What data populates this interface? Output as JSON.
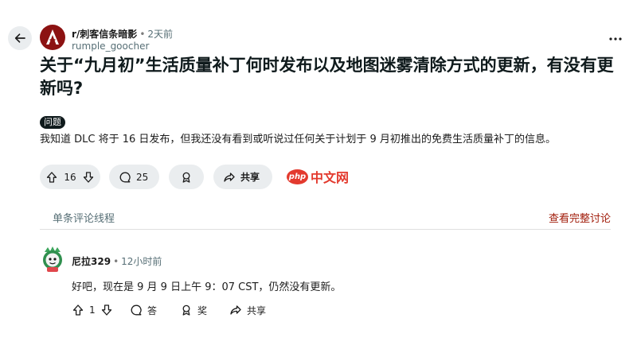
{
  "post": {
    "subreddit": "r/刺客信条暗影",
    "time": "2天前",
    "author": "rumple_goocher",
    "title": "关于“九月初”生活质量补丁何时发布以及地图迷雾清除方式的更新，有没有更新吗?",
    "flair": "问题",
    "body": "我知道 DLC 将于 16 日发布，但我还没有看到或听说过任何关于计划于 9 月初推出的免费生活质量补丁的信息。",
    "votes": "16",
    "comments": "25",
    "share_label": "共享"
  },
  "watermark": {
    "logo_text": "php",
    "text": "中文网"
  },
  "thread": {
    "label": "单条评论线程",
    "view_all": "查看完整讨论"
  },
  "comment": {
    "author": "尼拉329",
    "time": "12小时前",
    "body": "好吧，现在是 9 月 9 日上午 9：07 CST，仍然没有更新。",
    "votes": "1",
    "reply_label": "答",
    "award_label": "奖",
    "share_label": "共享"
  },
  "colors": {
    "accent": "#a11c0a",
    "pill_bg": "#eaedef",
    "watermark": "#e33a2e",
    "subreddit_avatar": "#8c1212"
  }
}
